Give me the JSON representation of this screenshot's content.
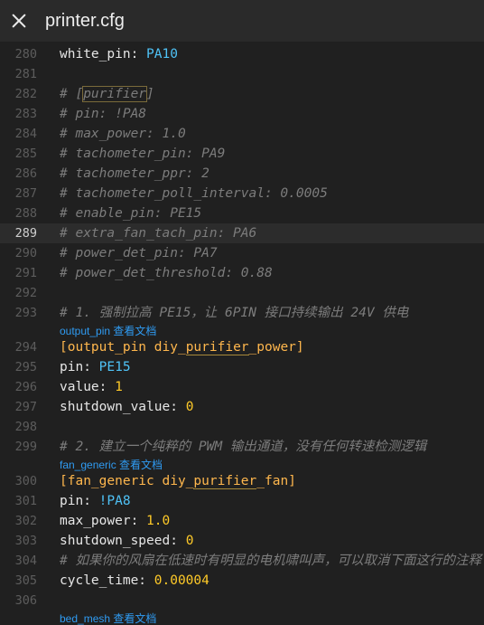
{
  "header": {
    "title": "printer.cfg",
    "close_icon": "close-icon"
  },
  "lines": [
    {
      "n": "280",
      "parts": [
        {
          "k": "key",
          "t": "white_pin: "
        },
        {
          "k": "val",
          "t": "PA10"
        }
      ]
    },
    {
      "n": "281",
      "parts": []
    },
    {
      "n": "282",
      "parts": [
        {
          "k": "cm",
          "t": "# ["
        },
        {
          "k": "cm hl",
          "t": "purifier"
        },
        {
          "k": "cm",
          "t": "]"
        }
      ]
    },
    {
      "n": "283",
      "parts": [
        {
          "k": "cm",
          "t": "# pin: !PA8"
        }
      ]
    },
    {
      "n": "284",
      "parts": [
        {
          "k": "cm",
          "t": "# max_power: 1.0"
        }
      ]
    },
    {
      "n": "285",
      "parts": [
        {
          "k": "cm",
          "t": "# tachometer_pin: PA9"
        }
      ]
    },
    {
      "n": "286",
      "parts": [
        {
          "k": "cm",
          "t": "# tachometer_ppr: 2"
        }
      ]
    },
    {
      "n": "287",
      "parts": [
        {
          "k": "cm",
          "t": "# tachometer_poll_interval: 0.0005"
        }
      ]
    },
    {
      "n": "288",
      "parts": [
        {
          "k": "cm",
          "t": "# enable_pin: PE15"
        }
      ]
    },
    {
      "n": "289",
      "cur": true,
      "parts": [
        {
          "k": "cm",
          "t": "# extra_fan_tach_pin: PA6"
        }
      ]
    },
    {
      "n": "290",
      "parts": [
        {
          "k": "cm",
          "t": "# power_det_pin: PA7"
        }
      ]
    },
    {
      "n": "291",
      "parts": [
        {
          "k": "cm",
          "t": "# power_det_threshold: 0.88"
        }
      ]
    },
    {
      "n": "292",
      "parts": []
    },
    {
      "n": "293",
      "parts": [
        {
          "k": "cm",
          "t": "# 1. 强制拉高 PE15，让 6PIN 接口持续输出 24V 供电"
        }
      ]
    },
    {
      "link": "output_pin 查看文档"
    },
    {
      "n": "294",
      "parts": [
        {
          "k": "sec",
          "t": "[output_pin diy_"
        },
        {
          "k": "sec ul",
          "t": "purifier"
        },
        {
          "k": "sec",
          "t": "_power]"
        }
      ]
    },
    {
      "n": "295",
      "parts": [
        {
          "k": "key",
          "t": "pin: "
        },
        {
          "k": "val",
          "t": "PE15"
        }
      ]
    },
    {
      "n": "296",
      "parts": [
        {
          "k": "key",
          "t": "value: "
        },
        {
          "k": "num",
          "t": "1"
        }
      ]
    },
    {
      "n": "297",
      "parts": [
        {
          "k": "key",
          "t": "shutdown_value: "
        },
        {
          "k": "num",
          "t": "0"
        }
      ]
    },
    {
      "n": "298",
      "parts": []
    },
    {
      "n": "299",
      "parts": [
        {
          "k": "cm",
          "t": "# 2. 建立一个纯粹的 PWM 输出通道，没有任何转速检测逻辑"
        }
      ]
    },
    {
      "link": "fan_generic 查看文档"
    },
    {
      "n": "300",
      "parts": [
        {
          "k": "sec",
          "t": "[fan_generic diy_"
        },
        {
          "k": "sec ul",
          "t": "purifier"
        },
        {
          "k": "sec",
          "t": "_fan]"
        }
      ]
    },
    {
      "n": "301",
      "parts": [
        {
          "k": "key",
          "t": "pin: "
        },
        {
          "k": "val",
          "t": "!PA8"
        }
      ]
    },
    {
      "n": "302",
      "parts": [
        {
          "k": "key",
          "t": "max_power: "
        },
        {
          "k": "num",
          "t": "1.0"
        }
      ]
    },
    {
      "n": "303",
      "parts": [
        {
          "k": "key",
          "t": "shutdown_speed: "
        },
        {
          "k": "num",
          "t": "0"
        }
      ]
    },
    {
      "n": "304",
      "parts": [
        {
          "k": "cm",
          "t": "# 如果你的风扇在低速时有明显的电机啸叫声，可以取消下面这行的注释"
        }
      ]
    },
    {
      "n": "305",
      "parts": [
        {
          "k": "key",
          "t": "cycle_time: "
        },
        {
          "k": "num",
          "t": "0.00004"
        }
      ]
    },
    {
      "n": "306",
      "parts": []
    },
    {
      "link": "bed_mesh 查看文档"
    }
  ]
}
